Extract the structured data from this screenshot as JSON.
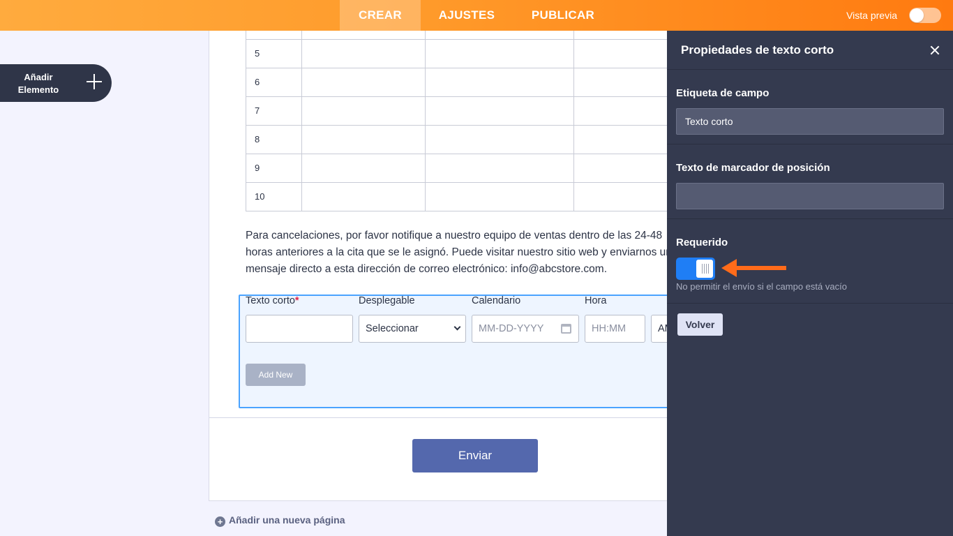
{
  "topbar": {
    "tabs": [
      {
        "label": "CREAR",
        "active": true
      },
      {
        "label": "AJUSTES",
        "active": false
      },
      {
        "label": "PUBLICAR",
        "active": false
      }
    ],
    "preview_label": "Vista previa"
  },
  "sidebar": {
    "add_element_label": "Añadir Elemento"
  },
  "table": {
    "rows": [
      "5",
      "6",
      "7",
      "8",
      "9",
      "10"
    ]
  },
  "paragraph": {
    "lines": [
      "Para cancelaciones, por favor notifique a nuestro equipo de ventas dentro de las 24-48",
      "horas anteriores a la cita que se le asignó. Puede visitar nuestro sitio web y enviarnos un",
      "mensaje directo a esta dirección de correo electrónico: info@abcstore.com."
    ]
  },
  "field_row": {
    "short_text_label": "Texto corto",
    "required_mark": "*",
    "dropdown_label": "Desplegable",
    "dropdown_value": "Seleccionar",
    "calendar_label": "Calendario",
    "calendar_placeholder": "MM-DD-YYYY",
    "time_label": "Hora",
    "time_placeholder": "HH:MM",
    "ampm_value": "AM",
    "add_new_label": "Add New"
  },
  "submit_label": "Enviar",
  "add_page_label": "Añadir una nueva página",
  "panel": {
    "title": "Propiedades de texto corto",
    "field_label_heading": "Etiqueta de campo",
    "field_label_value": "Texto corto",
    "placeholder_heading": "Texto de marcador de posición",
    "placeholder_value": "",
    "required_heading": "Requerido",
    "required_on": true,
    "required_hint": "No permitir el envío si el campo está vacío",
    "back_label": "Volver"
  },
  "colors": {
    "topbar_start": "#ffab3e",
    "topbar_end": "#ff7a10",
    "panel_bg": "#343a4f",
    "toggle_on": "#1f7ef5",
    "arrow": "#ff6b1a",
    "submit": "#5468ad"
  }
}
